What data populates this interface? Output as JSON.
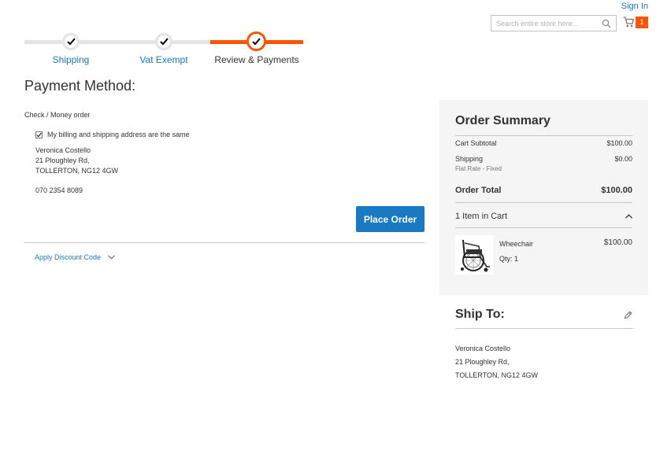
{
  "header": {
    "sign_in": "Sign In",
    "search_placeholder": "Search entire store here...",
    "cart_count": "1"
  },
  "progress": {
    "steps": [
      {
        "label": "Shipping",
        "state": "complete"
      },
      {
        "label": "Vat Exempt",
        "state": "complete"
      },
      {
        "label": "Review & Payments",
        "state": "active"
      }
    ]
  },
  "payment": {
    "title": "Payment Method:",
    "method": "Check / Money order",
    "same_address_label": "My billing and shipping address are the same",
    "same_address_checked": true,
    "address_lines": [
      "Veronica Costello",
      "21 Ploughley Rd,",
      "TOLLERTON, NG12 4GW"
    ],
    "phone": "070 2354 8089",
    "place_order": "Place Order",
    "discount_link": "Apply Discount Code"
  },
  "summary": {
    "title": "Order Summary",
    "subtotal_label": "Cart Subtotal",
    "subtotal_value": "$100.00",
    "shipping_label": "Shipping",
    "shipping_method": "Flat Rate - Fixed",
    "shipping_value": "$0.00",
    "total_label": "Order Total",
    "total_value": "$100.00",
    "items_in_cart": "1 Item in Cart",
    "item": {
      "name": "Wheechair",
      "price": "$100.00",
      "qty_label": "Qty:",
      "qty": "1",
      "image_icon": "wheelchair-icon"
    }
  },
  "ship_to": {
    "title": "Ship To:",
    "lines": [
      "Veronica Costello",
      "21 Ploughley Rd,",
      "TOLLERTON, NG12 4GW"
    ]
  },
  "colors": {
    "accent": "#1979c3",
    "progress_active": "#ff5501",
    "progress_inactive": "#e4e4e4",
    "summary_bg": "#f5f5f5"
  }
}
